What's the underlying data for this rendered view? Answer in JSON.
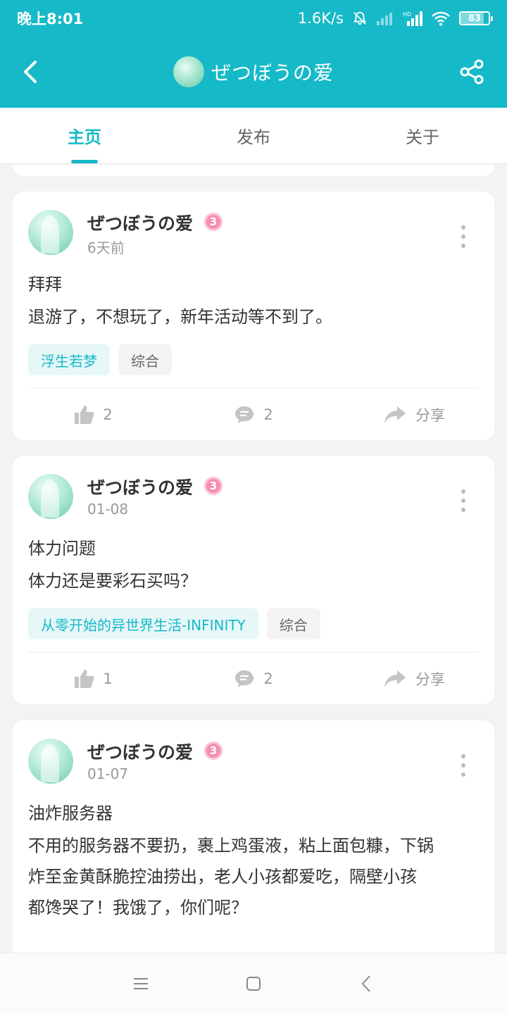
{
  "status_bar": {
    "time": "晚上8:01",
    "network_speed": "1.6K/s",
    "battery": "83",
    "icons": [
      "bell-off-icon",
      "signal-icon",
      "hd-signal-icon",
      "wifi-icon",
      "battery-icon"
    ]
  },
  "header": {
    "title": "ぜつぼうの爱",
    "background_color": "#16b9c8",
    "icons": [
      "back-arrow-icon",
      "share-icon"
    ]
  },
  "tabs": [
    {
      "label": "主页",
      "active": true
    },
    {
      "label": "发布",
      "active": false
    },
    {
      "label": "关于",
      "active": false
    }
  ],
  "accent_color": "#16b9c8",
  "posts": [
    {
      "author": "ぜつぼうの爱",
      "level": "3",
      "time": "6天前",
      "title": "拜拜",
      "body": "退游了，不想玩了，新年活动等不到了。",
      "game_tag": "浮生若梦",
      "category_tag": "综合",
      "likes": "2",
      "comments": "2",
      "share_label": "分享"
    },
    {
      "author": "ぜつぼうの爱",
      "level": "3",
      "time": "01-08",
      "title": "体力问题",
      "body": "体力还是要彩石买吗？",
      "game_tag": "从零开始的异世界生活-INFINITY",
      "category_tag": "综合",
      "likes": "1",
      "comments": "2",
      "share_label": "分享"
    },
    {
      "author": "ぜつぼうの爱",
      "level": "3",
      "time": "01-07",
      "title": "油炸服务器",
      "body_lines": [
        "不用的服务器不要扔，裹上鸡蛋液，粘上面包糠，下锅",
        "炸至金黄酥脆控油捞出，老人小孩都爱吃，隔壁小孩",
        "都馋哭了！我饿了，你们呢？"
      ]
    }
  ],
  "system_nav": {
    "icons": [
      "menu-icon",
      "home-icon",
      "back-icon"
    ]
  }
}
